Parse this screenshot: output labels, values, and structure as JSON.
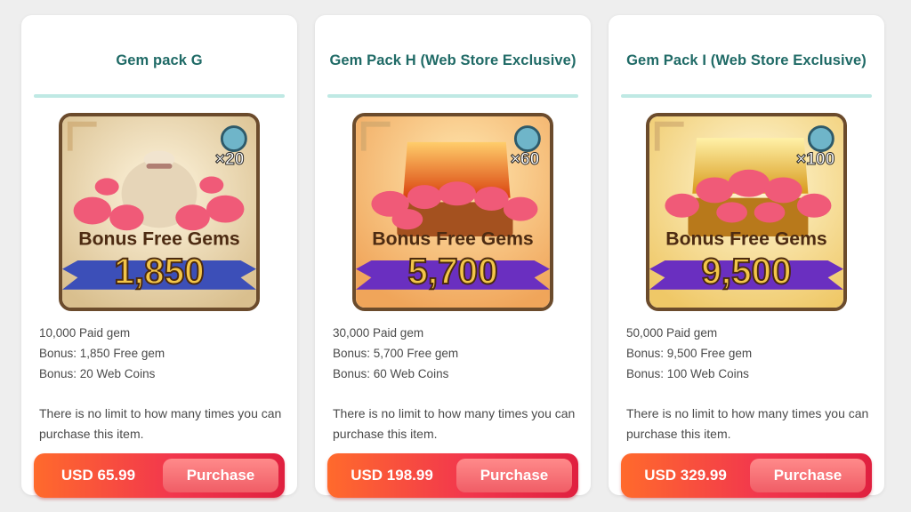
{
  "packs": [
    {
      "title": "Gem pack G",
      "image": {
        "theme": "gem-bag",
        "multiplier": "×20",
        "banner_text": "Bonus Free Gems",
        "banner_amount": "1,850",
        "background_color": "#e9d8b4",
        "ribbon_color": "#3c4fb8"
      },
      "details": [
        "10,000 Paid gem",
        "Bonus: 1,850 Free gem",
        "Bonus: 20 Web Coins"
      ],
      "limit_note": "There is no limit to how many times you can purchase this item.",
      "price": "USD 65.99",
      "purchase_label": "Purchase"
    },
    {
      "title": "Gem Pack H (Web Store Exclusive)",
      "image": {
        "theme": "treasure-chest",
        "multiplier": "×60",
        "banner_text": "Bonus Free Gems",
        "banner_amount": "5,700",
        "background_color": "#f6c98e",
        "ribbon_color": "#6a2fc0"
      },
      "details": [
        "30,000 Paid gem",
        "Bonus: 5,700 Free gem",
        "Bonus: 60 Web Coins"
      ],
      "limit_note": "There is no limit to how many times you can purchase this item.",
      "price": "USD 198.99",
      "purchase_label": "Purchase"
    },
    {
      "title": "Gem Pack I (Web Store Exclusive)",
      "image": {
        "theme": "golden-chest",
        "multiplier": "×100",
        "banner_text": "Bonus Free Gems",
        "banner_amount": "9,500",
        "background_color": "#f7dc8a",
        "ribbon_color": "#6a2fc0"
      },
      "details": [
        "50,000 Paid gem",
        "Bonus: 9,500 Free gem",
        "Bonus: 100 Web Coins"
      ],
      "limit_note": "There is no limit to how many times you can purchase this item.",
      "price": "USD 329.99",
      "purchase_label": "Purchase"
    }
  ],
  "colors": {
    "title": "#1f6a66",
    "title_rule": "#bfe9e4",
    "price_gradient_start": "#ff6a2c",
    "price_gradient_end": "#e0203f",
    "purchase_button": "#f05d66"
  }
}
